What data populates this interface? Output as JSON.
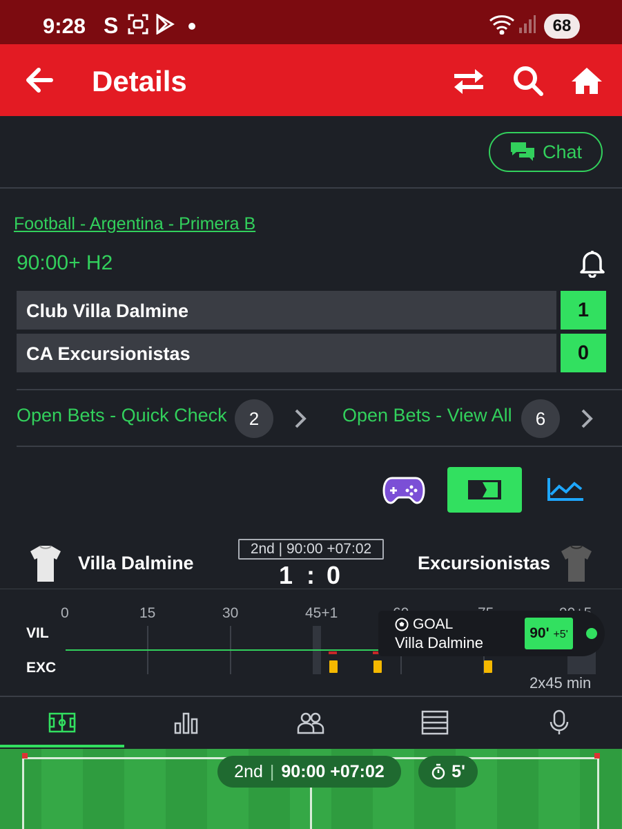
{
  "status_bar": {
    "time": "9:28",
    "battery": "68",
    "icons": [
      "swipe-s-icon",
      "screenshot-icon",
      "play-store-icon",
      "wifi-icon",
      "signal-icon"
    ]
  },
  "app_bar": {
    "title": "Details",
    "icons": [
      "back-arrow-icon",
      "swap-icon",
      "search-icon",
      "home-icon"
    ]
  },
  "chat": {
    "label": "Chat"
  },
  "match": {
    "breadcrumb": "Football - Argentina - Primera B",
    "clock": "90:00+ H2",
    "teams": [
      {
        "name": "Club Villa Dalmine",
        "score": "1"
      },
      {
        "name": "CA Excursionistas",
        "score": "0"
      }
    ]
  },
  "bets": {
    "quick_check_label": "Open Bets - Quick Check",
    "quick_check_count": "2",
    "view_all_label": "Open Bets - View All",
    "view_all_count": "6"
  },
  "view_switch": [
    "gamepad-icon",
    "video-icon",
    "stats-chart-icon"
  ],
  "scoreboard": {
    "home": "Villa Dalmine",
    "away": "Excursionistas",
    "period": "2nd | 90:00 +07:02",
    "home_score": "1",
    "separator": ":",
    "away_score": "0"
  },
  "timeline": {
    "ticks": [
      "0",
      "15",
      "30",
      "45+1",
      "60",
      "75",
      "90+5"
    ],
    "home_abbr": "VIL",
    "away_abbr": "EXC",
    "duration": "2x45 min",
    "goal_popup": {
      "type": "GOAL",
      "team": "Villa Dalmine",
      "minute": "90'",
      "added": "+5'"
    }
  },
  "tabs": [
    "pitch-icon",
    "stats-icon",
    "lineups-icon",
    "table-icon",
    "commentary-mic-icon"
  ],
  "pitch": {
    "period": "2nd",
    "time": "90:00 +07:02",
    "added_time": "5'"
  },
  "colors": {
    "accent_green": "#32e060",
    "brand_red": "#e31b23",
    "status_bar": "#7c0b10",
    "background": "#1d2026",
    "card_yellow": "#f5b800"
  }
}
